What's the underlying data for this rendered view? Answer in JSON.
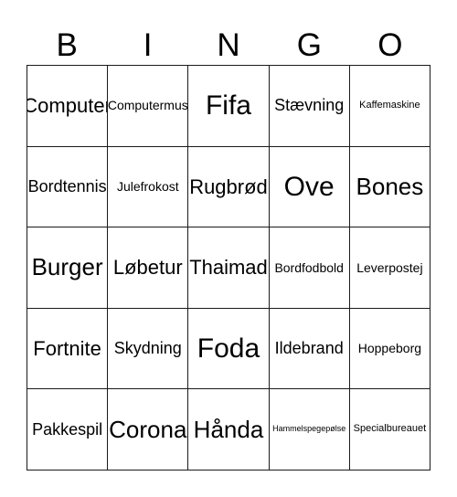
{
  "card": {
    "title": "BINGO",
    "header_letters": [
      "B",
      "I",
      "N",
      "G",
      "O"
    ],
    "rows": 5,
    "columns": 5,
    "colors": {
      "background": "#ffffff",
      "border": "#1a1a1a",
      "text": "#000000"
    },
    "cells": [
      [
        {
          "text": "Computer",
          "size": "lg"
        },
        {
          "text": "Computermus",
          "size": "sm"
        },
        {
          "text": "Fifa",
          "size": "xxl"
        },
        {
          "text": "Stævning",
          "size": "md"
        },
        {
          "text": "Kaffemaskine",
          "size": "xs"
        }
      ],
      [
        {
          "text": "Bordtennis",
          "size": "md"
        },
        {
          "text": "Julefrokost",
          "size": "sm"
        },
        {
          "text": "Rugbrød",
          "size": "lg"
        },
        {
          "text": "Ove",
          "size": "xxl"
        },
        {
          "text": "Bones",
          "size": "xl"
        }
      ],
      [
        {
          "text": "Burger",
          "size": "xl"
        },
        {
          "text": "Løbetur",
          "size": "lg"
        },
        {
          "text": "Thaimad",
          "size": "lg"
        },
        {
          "text": "Bordfodbold",
          "size": "sm"
        },
        {
          "text": "Leverpostej",
          "size": "sm"
        }
      ],
      [
        {
          "text": "Fortnite",
          "size": "lg"
        },
        {
          "text": "Skydning",
          "size": "md"
        },
        {
          "text": "Foda",
          "size": "xxl"
        },
        {
          "text": "Ildebrand",
          "size": "md"
        },
        {
          "text": "Hoppeborg",
          "size": "sm"
        }
      ],
      [
        {
          "text": "Pakkespil",
          "size": "md"
        },
        {
          "text": "Corona",
          "size": "xl"
        },
        {
          "text": "Hånda",
          "size": "xl"
        },
        {
          "text": "Hammelspegepølse",
          "size": "xxs"
        },
        {
          "text": "Specialbureauet",
          "size": "xs"
        }
      ]
    ]
  }
}
